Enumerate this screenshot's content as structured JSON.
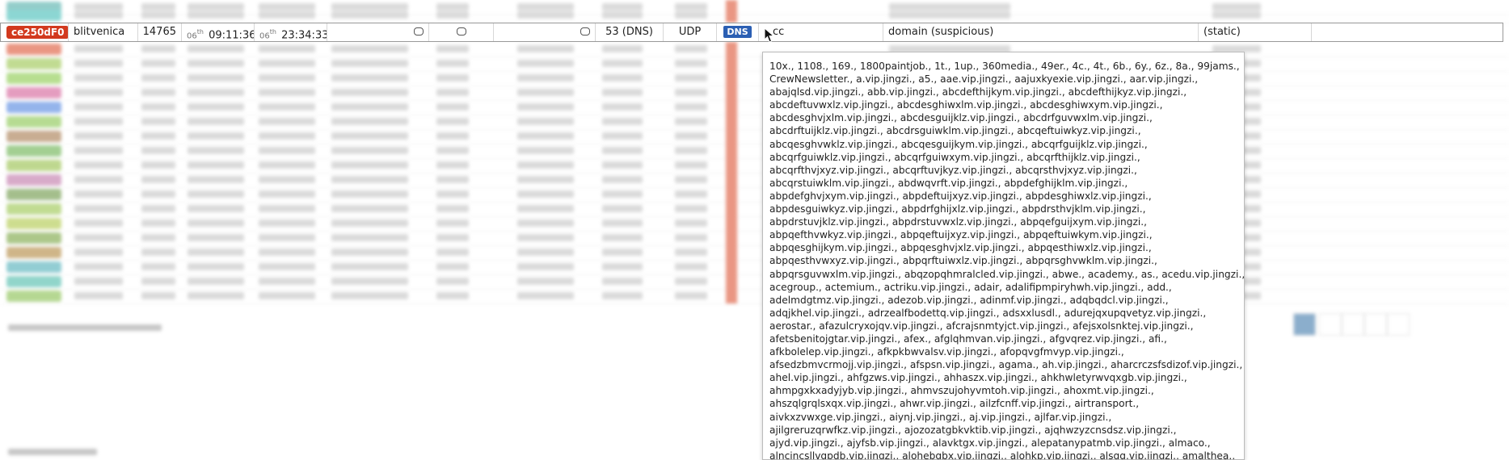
{
  "highlighted_row": {
    "id_badge": "ce250dF0",
    "host": "blitvenica",
    "count": "14765",
    "first_seen_day": "06",
    "first_seen_suffix": "th",
    "first_seen_time": "09:11:36",
    "last_seen_day": "06",
    "last_seen_suffix": "th",
    "last_seen_time": "23:34:33",
    "port_service": "53 (DNS)",
    "protocol": "UDP",
    "proto_badge": "DNS",
    "query": "cc",
    "category": "domain (suspicious)",
    "source": "(static)"
  },
  "colors": {
    "id_badge_bg": "#d2391e",
    "dns_badge_bg": "#2b5fb3"
  },
  "icons": [
    "comment-icon",
    "mouse-cursor-icon"
  ],
  "tooltip": {
    "lines": [
      "10x., 1108., 169., 1800paintjob., 1t., 1up., 360media., 49er., 4c., 4t., 6b., 6y., 6z., 8a., 99jams.,",
      "CrewNewsletter., a.vip.jingzi., a5., aae.vip.jingzi., aajuxkyexie.vip.jingzi., aar.vip.jingzi.,",
      "abajqlsd.vip.jingzi., abb.vip.jingzi., abcdefthijkym.vip.jingzi., abcdefthijkyz.vip.jingzi.,",
      "abcdeftuvwxlz.vip.jingzi., abcdesghiwxlm.vip.jingzi., abcdesghiwxym.vip.jingzi.,",
      "abcdesghvjxlm.vip.jingzi., abcdesguijklz.vip.jingzi., abcdrfguvwxlm.vip.jingzi.,",
      "abcdrftuijklz.vip.jingzi., abcdrsguiwklm.vip.jingzi., abcqeftuiwkyz.vip.jingzi.,",
      "abcqesghvwklz.vip.jingzi., abcqesguijkym.vip.jingzi., abcqrfguijklz.vip.jingzi.,",
      "abcqrfguiwklz.vip.jingzi., abcqrfguiwxym.vip.jingzi., abcqrfthijklz.vip.jingzi.,",
      "abcqrfthvjxyz.vip.jingzi., abcqrftuvjkyz.vip.jingzi., abcqrsthvjxyz.vip.jingzi.,",
      "abcqrstuiwklm.vip.jingzi., abdwqvrft.vip.jingzi., abpdefghijklm.vip.jingzi.,",
      "abpdefghvjxym.vip.jingzi., abpdeftuijxyz.vip.jingzi., abpdesghiwxlz.vip.jingzi.,",
      "abpdesguiwkyz.vip.jingzi., abpdrfghijxlz.vip.jingzi., abpdrsthvjklm.vip.jingzi.,",
      "abpdrstuvjklz.vip.jingzi., abpdrstuvwxlz.vip.jingzi., abpqefguijxym.vip.jingzi.,",
      "abpqefthvwkyz.vip.jingzi., abpqeftuijxyz.vip.jingzi., abpqeftuiwkym.vip.jingzi.,",
      "abpqesghijkym.vip.jingzi., abpqesghvjxlz.vip.jingzi., abpqesthiwxlz.vip.jingzi.,",
      "abpqesthvwxyz.vip.jingzi., abpqrftuiwxlz.vip.jingzi., abpqrsghvwklm.vip.jingzi.,",
      "abpqrsguvwxlm.vip.jingzi., abqzopqhmralcled.vip.jingzi., abwe., academy., as., acedu.vip.jingzi.,",
      "acegroup., actemium., actriku.vip.jingzi., adair, adalifipmpiryhwh.vip.jingzi., add.,",
      "adelmdgtmz.vip.jingzi., adezob.vip.jingzi., adinmf.vip.jingzi., adqbqdcl.vip.jingzi.,",
      "adqjkhel.vip.jingzi., adrzealfbodettq.vip.jingzi., adsxxlusdl., adurejqxupqvetyz.vip.jingzi.,",
      "aerostar., afazulcryxojqv.vip.jingzi., afcrajsnmtyjct.vip.jingzi., afejsxolsnktej.vip.jingzi.,",
      "afetsbenitojgtar.vip.jingzi., afex., afglqhmvan.vip.jingzi., afgvqrez.vip.jingzi., afi.,",
      "afkbolelep.vip.jingzi., afkpkbwvalsv.vip.jingzi., afopqvgfmvyp.vip.jingzi.,",
      "afsedzbmvcrmojj.vip.jingzi., afspsn.vip.jingzi., agama., ah.vip.jingzi., aharcrczsfsdizof.vip.jingzi.,",
      "ahel.vip.jingzi., ahfgzws.vip.jingzi., ahhaszx.vip.jingzi., ahkhwletyrwvqxgb.vip.jingzi.,",
      "ahmpgxkxadyjyb.vip.jingzi., ahmvszujohyvmtoh.vip.jingzi., ahoxmt.vip.jingzi.,",
      "ahszqlgrqlsxqx.vip.jingzi., ahwr.vip.jingzi., ailzfcnff.vip.jingzi., airtransport.,",
      "aivkxzvwxge.vip.jingzi., aiynj.vip.jingzi., aj.vip.jingzi., ajlfar.vip.jingzi.,",
      "ajilgreruzqrwfkz.vip.jingzi., ajozozatgbkvktib.vip.jingzi., ajqhwzyzcnsdsz.vip.jingzi.,",
      "ajyd.vip.jingzi., ajyfsb.vip.jingzi., alavktgx.vip.jingzi., alepatanypatmb.vip.jingzi., almaco.,",
      "alncjncsllvgpdb.vip.jingzi., alohebgbx.vip.jingzi., alohkp.vip.jingzi., alsgq.vip.jingzi., amalthea.,"
    ]
  }
}
